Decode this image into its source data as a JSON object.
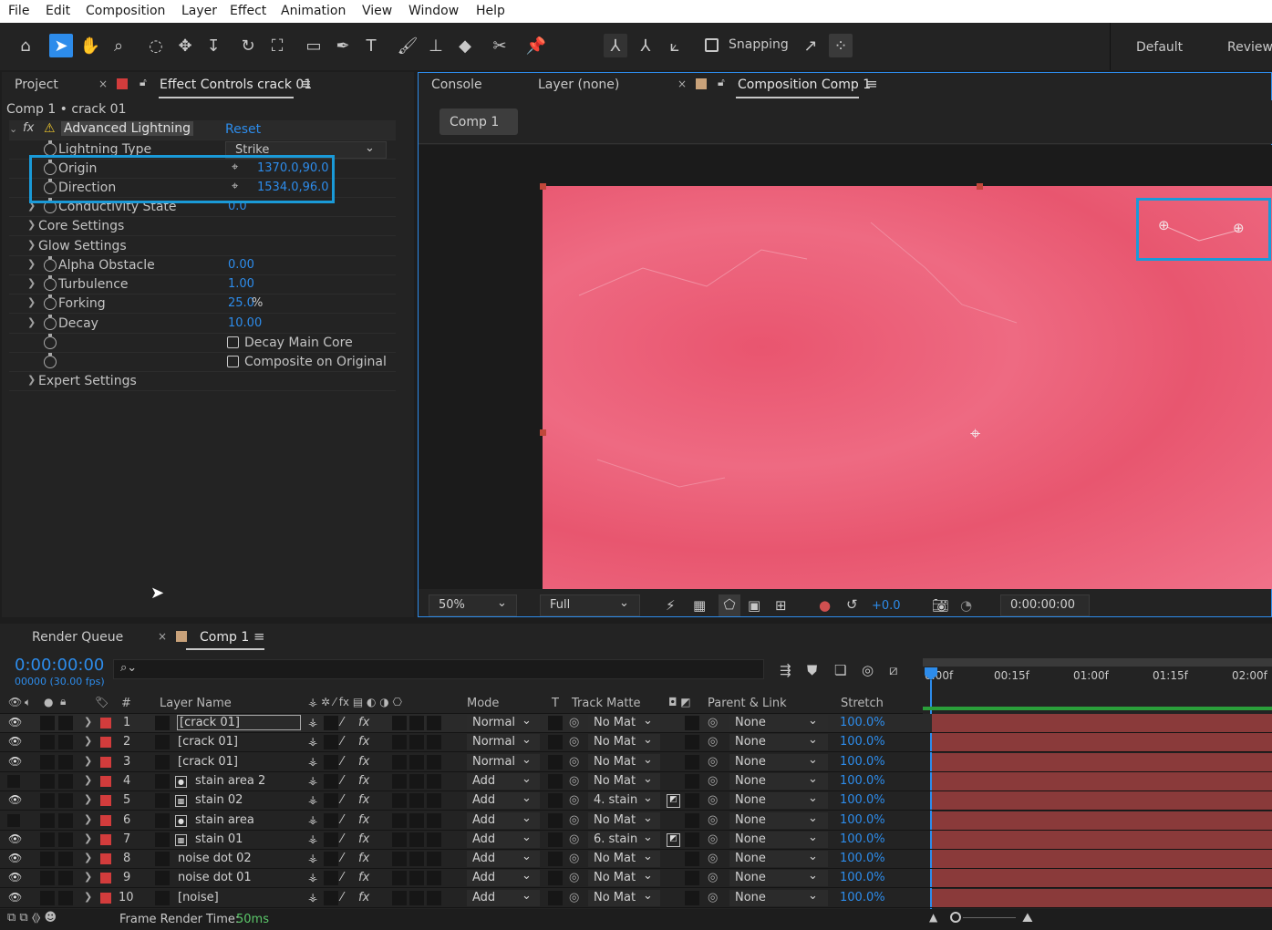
{
  "menu": [
    "File",
    "Edit",
    "Composition",
    "Layer",
    "Effect",
    "Animation",
    "View",
    "Window",
    "Help"
  ],
  "toolbar": {
    "snapping": "Snapping",
    "workspaces": [
      "Default",
      "Review"
    ]
  },
  "project_panel": {
    "tab_project": "Project",
    "tab_effect_controls": "Effect Controls crack 01",
    "breadcrumb": "Comp 1 • crack 01"
  },
  "effect": {
    "name": "Advanced Lightning",
    "reset": "Reset",
    "props": [
      {
        "label": "Lightning Type",
        "value": "Strike",
        "kind": "dropdown"
      },
      {
        "label": "Origin",
        "value": "1370.0,90.0",
        "kind": "point"
      },
      {
        "label": "Direction",
        "value": "1534.0,96.0",
        "kind": "point"
      },
      {
        "label": "Conductivity State",
        "value": "0.0",
        "kind": "num"
      },
      {
        "label": "Core Settings",
        "value": "",
        "kind": "group"
      },
      {
        "label": "Glow Settings",
        "value": "",
        "kind": "group"
      },
      {
        "label": "Alpha Obstacle",
        "value": "0.00",
        "kind": "num"
      },
      {
        "label": "Turbulence",
        "value": "1.00",
        "kind": "num"
      },
      {
        "label": "Forking",
        "value": "25.0",
        "unit": "%",
        "kind": "num"
      },
      {
        "label": "Decay",
        "value": "10.00",
        "kind": "num"
      },
      {
        "label": "Decay Main Core",
        "value": "",
        "kind": "check"
      },
      {
        "label": "Composite on Original",
        "value": "",
        "kind": "check"
      },
      {
        "label": "Expert Settings",
        "value": "",
        "kind": "group"
      }
    ]
  },
  "comp_panel": {
    "tab_console": "Console",
    "tab_layer": "Layer (none)",
    "tab_comp": "Composition Comp 1",
    "comp_button": "Comp 1",
    "zoom": "50%",
    "resolution": "Full",
    "exposure": "+0.0",
    "timecode": "0:00:00:00"
  },
  "timeline": {
    "tab_render": "Render Queue",
    "tab_comp": "Comp 1",
    "timecode": "0:00:00:00",
    "frame_info": "00000 (30.00 fps)",
    "ruler": [
      "0:00f",
      "00:15f",
      "01:00f",
      "01:15f",
      "02:00f"
    ],
    "headers": {
      "num": "#",
      "layer_name": "Layer Name",
      "mode": "Mode",
      "t": "T",
      "track_matte": "Track Matte",
      "parent": "Parent & Link",
      "stretch": "Stretch"
    },
    "layers": [
      {
        "num": "1",
        "name": "[crack 01]",
        "mode": "Normal",
        "matte": "No Mat",
        "parent": "None",
        "stretch": "100.0%",
        "eye": true,
        "icon": "none"
      },
      {
        "num": "2",
        "name": "[crack 01]",
        "mode": "Normal",
        "matte": "No Mat",
        "parent": "None",
        "stretch": "100.0%",
        "eye": true,
        "icon": "none"
      },
      {
        "num": "3",
        "name": "[crack 01]",
        "mode": "Normal",
        "matte": "No Mat",
        "parent": "None",
        "stretch": "100.0%",
        "eye": true,
        "icon": "none"
      },
      {
        "num": "4",
        "name": "stain area 2",
        "mode": "Add",
        "matte": "No Mat",
        "parent": "None",
        "stretch": "100.0%",
        "eye": false,
        "icon": "solid"
      },
      {
        "num": "5",
        "name": "stain 02",
        "mode": "Add",
        "matte": "4. stain",
        "parent": "None",
        "stretch": "100.0%",
        "eye": true,
        "icon": "comp"
      },
      {
        "num": "6",
        "name": "stain area",
        "mode": "Add",
        "matte": "No Mat",
        "parent": "None",
        "stretch": "100.0%",
        "eye": false,
        "icon": "solid"
      },
      {
        "num": "7",
        "name": "stain 01",
        "mode": "Add",
        "matte": "6. stain",
        "parent": "None",
        "stretch": "100.0%",
        "eye": true,
        "icon": "comp"
      },
      {
        "num": "8",
        "name": "noise dot 02",
        "mode": "Add",
        "matte": "No Mat",
        "parent": "None",
        "stretch": "100.0%",
        "eye": true,
        "icon": "none"
      },
      {
        "num": "9",
        "name": "noise dot 01",
        "mode": "Add",
        "matte": "No Mat",
        "parent": "None",
        "stretch": "100.0%",
        "eye": true,
        "icon": "none"
      },
      {
        "num": "10",
        "name": "[noise]",
        "mode": "Add",
        "matte": "No Mat",
        "parent": "None",
        "stretch": "100.0%",
        "eye": true,
        "icon": "none"
      }
    ],
    "footer_label": "Frame Render Time:",
    "footer_value": "50ms"
  },
  "colors": {
    "accent": "#2d8ceb",
    "highlight": "#1a9ad8",
    "comp_pink": "#ee5d78",
    "label_red": "#d23c3c"
  }
}
